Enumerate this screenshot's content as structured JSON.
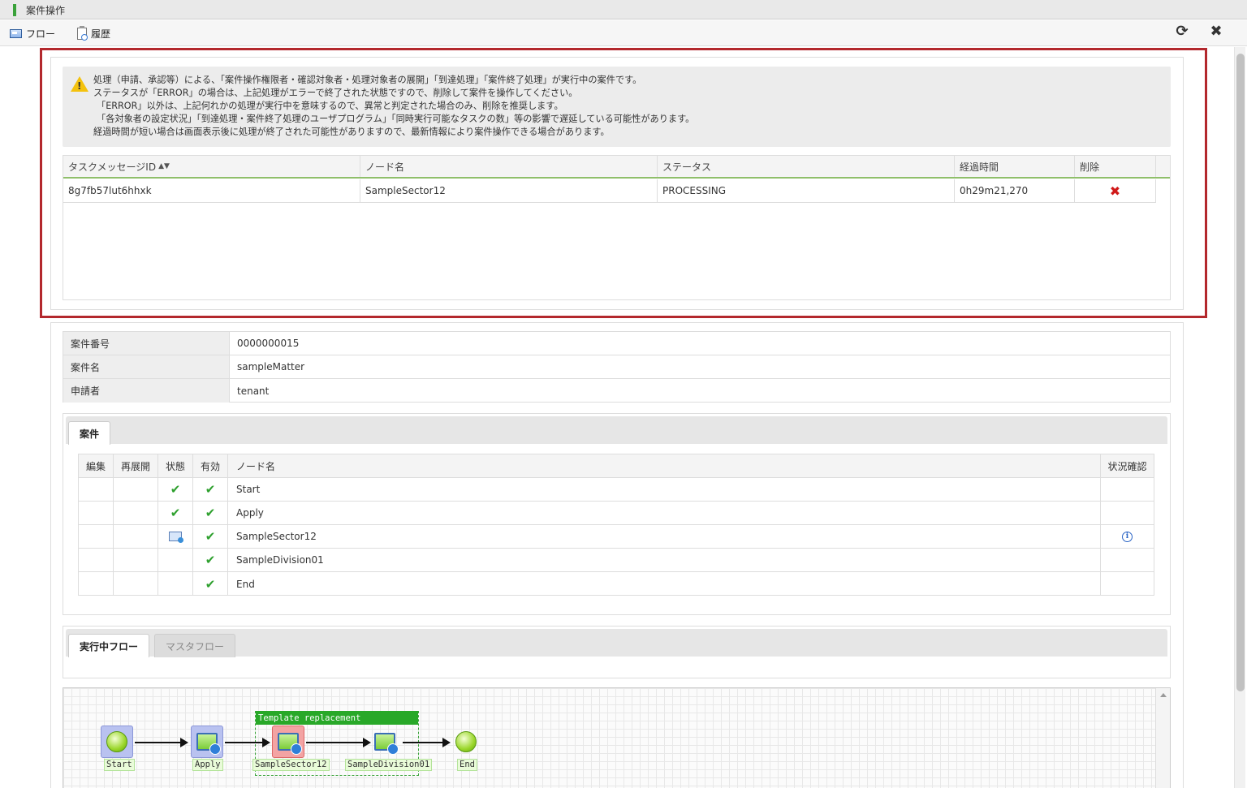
{
  "window": {
    "title": "案件操作"
  },
  "toolbar": {
    "flow_label": "フロー",
    "history_label": "履歴",
    "refresh_icon": "⟳",
    "close_icon": "✖"
  },
  "warning": {
    "lines": [
      "処理（申請、承認等）による、「案件操作権限者・確認対象者・処理対象者の展開」「到達処理」「案件終了処理」が実行中の案件です。",
      "ステータスが「ERROR」の場合は、上記処理がエラーで終了された状態ですので、削除して案件を操作してください。",
      "「ERROR」以外は、上記何れかの処理が実行中を意味するので、異常と判定された場合のみ、削除を推奨します。",
      "「各対象者の設定状況」「到達処理・案件終了処理のユーザプログラム」「同時実行可能なタスクの数」等の影響で遅延している可能性があります。",
      "経過時間が短い場合は画面表示後に処理が終了された可能性がありますので、最新情報により案件操作できる場合があります。"
    ]
  },
  "task_table": {
    "headers": [
      "タスクメッセージID",
      "ノード名",
      "ステータス",
      "経過時間",
      "削除"
    ],
    "sort_icon": "▲▼",
    "rows": [
      {
        "id": "8g7fb57lut6hhxk",
        "node": "SampleSector12",
        "status": "PROCESSING",
        "elapsed": "0h29m21,270",
        "delete": "✖"
      }
    ]
  },
  "matter_info": [
    {
      "label": "案件番号",
      "value": "0000000015"
    },
    {
      "label": "案件名",
      "value": "sampleMatter"
    },
    {
      "label": "申請者",
      "value": "tenant"
    }
  ],
  "matter_tab": {
    "label": "案件"
  },
  "node_table": {
    "headers": [
      "編集",
      "再展開",
      "状態",
      "有効",
      "ノード名",
      "状況確認"
    ],
    "rows": [
      {
        "state": "check",
        "valid": "check",
        "name": "Start",
        "status_check": ""
      },
      {
        "state": "check",
        "valid": "check",
        "name": "Apply",
        "status_check": ""
      },
      {
        "state": "processing",
        "valid": "check",
        "name": "SampleSector12",
        "status_check": "info"
      },
      {
        "state": "",
        "valid": "check",
        "name": "SampleDivision01",
        "status_check": ""
      },
      {
        "state": "",
        "valid": "check",
        "name": "End",
        "status_check": ""
      }
    ],
    "check_glyph": "✔",
    "info_glyph": "i"
  },
  "flow_tabs": {
    "running": "実行中フロー",
    "master": "マスタフロー"
  },
  "flow_diagram": {
    "template_title": "Template replacement",
    "nodes": [
      "Start",
      "Apply",
      "SampleSector12",
      "SampleDivision01",
      "End"
    ]
  },
  "colors": {
    "accent_green": "#28a828",
    "highlight_red": "#b3282d",
    "delete_red": "#d01a1a"
  }
}
